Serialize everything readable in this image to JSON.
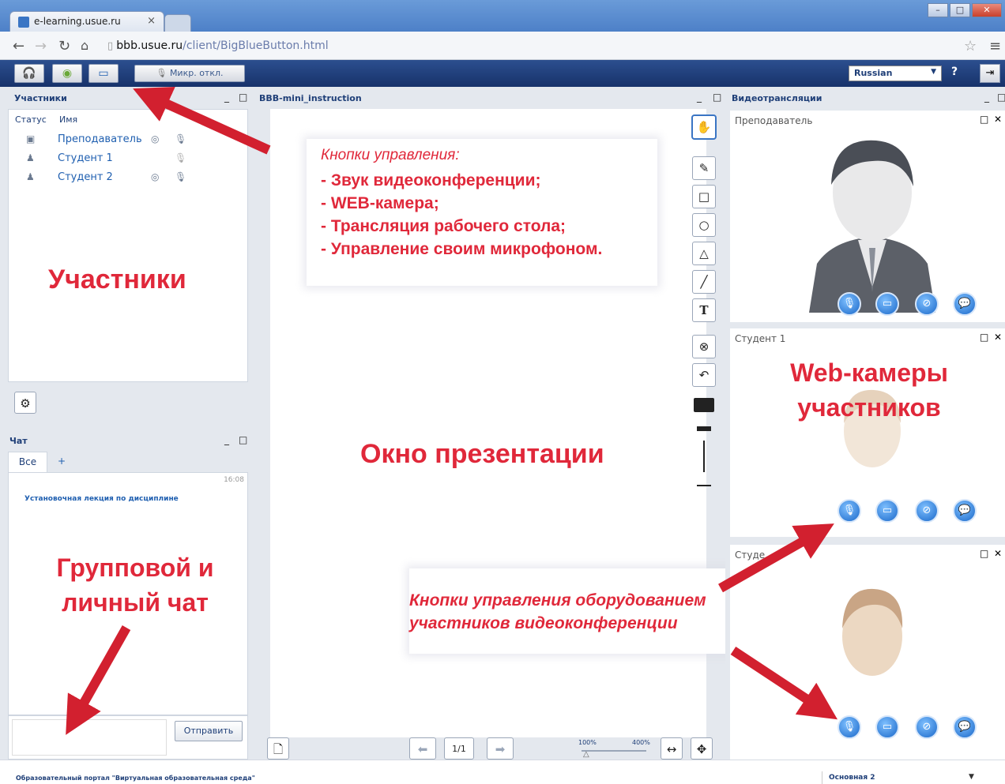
{
  "browser": {
    "tab_title": "e-learning.usue.ru",
    "url_host": "bbb.usue.ru",
    "url_path": "/client/BigBlueButton.html"
  },
  "toolbar": {
    "mic_label": "Микр. откл.",
    "language": "Russian",
    "help": "?"
  },
  "participants": {
    "title": "Участники",
    "col_status": "Статус",
    "col_name": "Имя",
    "users": [
      {
        "name": "Преподаватель"
      },
      {
        "name": "Студент 1"
      },
      {
        "name": "Студент 2"
      }
    ],
    "annotation": "Участники"
  },
  "chat": {
    "title": "Чат",
    "tab_all": "Все",
    "tab_add": "+",
    "time": "16:08",
    "message": "Установочная лекция по дисциплине",
    "send_label": "Отправить",
    "annotation_line1": "Групповой и",
    "annotation_line2": "личный чат"
  },
  "presentation": {
    "title": "BBB-mini_instruction",
    "callout_heading": "Кнопки управления:",
    "callout_items": [
      "- Звук видеоконференции;",
      "- WEB-камера;",
      "- Трансляция рабочего стола;",
      "- Управление своим микрофоном."
    ],
    "annotation": "Окно презентации",
    "page": "1/1",
    "zoom_min": "100%",
    "zoom_max": "400%",
    "bottom_note_line1": "Кнопки управления оборудованием",
    "bottom_note_line2": "участников видеоконференции"
  },
  "video": {
    "title": "Видеотрансляции",
    "cam1": "Преподаватель",
    "cam2": "Студент 1",
    "cam3": "Студе",
    "annotation_line1": "Web-камеры",
    "annotation_line2": "участников"
  },
  "footer": {
    "left_text": "Образовательный портал \"Виртуальная образовательная среда\"",
    "layout": "Основная 2"
  }
}
